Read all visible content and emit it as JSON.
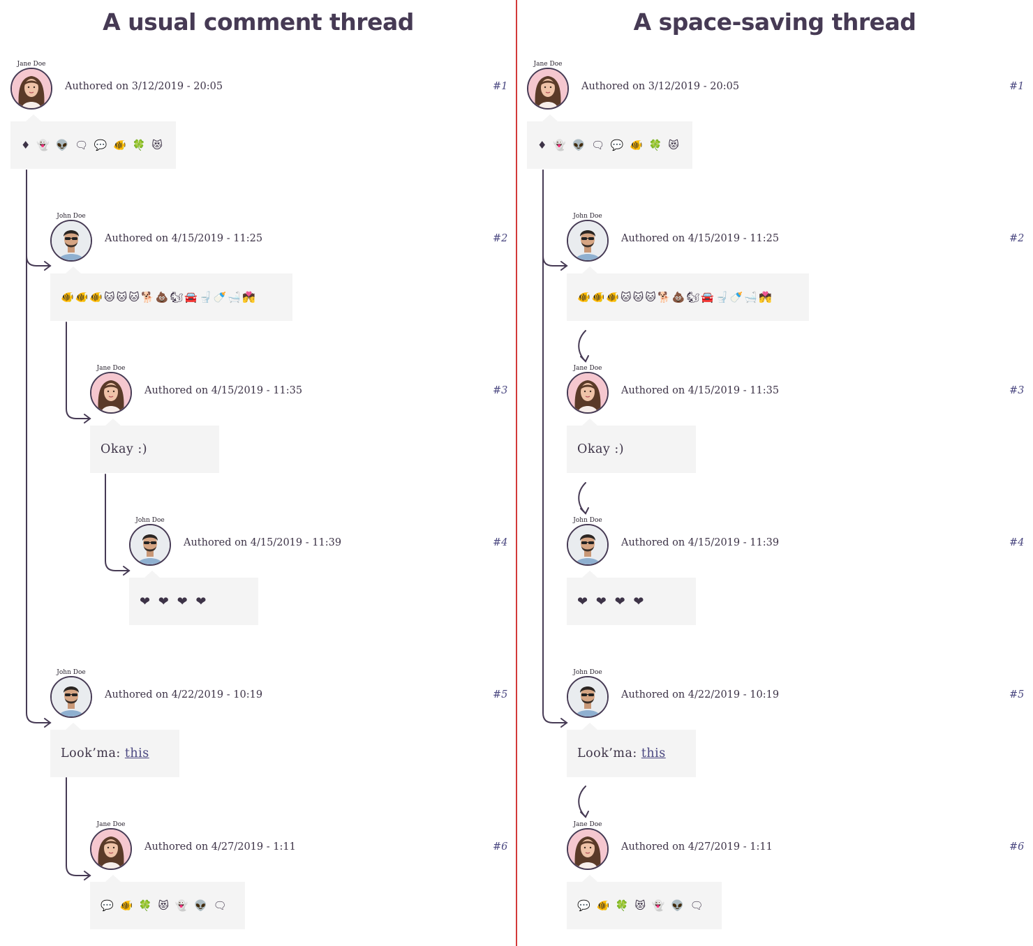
{
  "panels": [
    {
      "title": "A usual comment thread"
    },
    {
      "title": "A space-saving thread"
    }
  ],
  "comments": [
    {
      "author": "Jane Doe",
      "avatar": "female-avatar",
      "meta": "Authored on 3/12/2019 - 20:05",
      "num": "#1",
      "body": "♦ 👻 👽 🗨 💬 🐠 🍀 😻",
      "kind": "emoji"
    },
    {
      "author": "John Doe",
      "avatar": "male-avatar",
      "meta": "Authored on 4/15/2019 - 11:25",
      "num": "#2",
      "body": "🐠🐠🐠🐱🐱🐱🐕💩🐿🚘🚽🍼🛁💏",
      "kind": "emoji"
    },
    {
      "author": "Jane Doe",
      "avatar": "female-avatar",
      "meta": "Authored on 4/15/2019 - 11:35",
      "num": "#3",
      "body": "Okay :)",
      "kind": "text"
    },
    {
      "author": "John Doe",
      "avatar": "male-avatar",
      "meta": "Authored on 4/15/2019 - 11:39",
      "num": "#4",
      "body": "❤ ❤ ❤ ❤",
      "kind": "hearts"
    },
    {
      "author": "John Doe",
      "avatar": "male-avatar",
      "meta": "Authored on 4/22/2019 - 10:19",
      "num": "#5",
      "body_prefix": "Look’ma: ",
      "link": "this",
      "kind": "link"
    },
    {
      "author": "Jane Doe",
      "avatar": "female-avatar",
      "meta": "Authored on 4/27/2019 - 1:11",
      "num": "#6",
      "body": "💬 🐠 🍀 😻 👻 👽 🗨",
      "kind": "emoji"
    }
  ],
  "colors": {
    "accent": "#463a54",
    "link": "#4a4780",
    "divider": "#d33a3a",
    "bubble": "#f4f4f4"
  }
}
